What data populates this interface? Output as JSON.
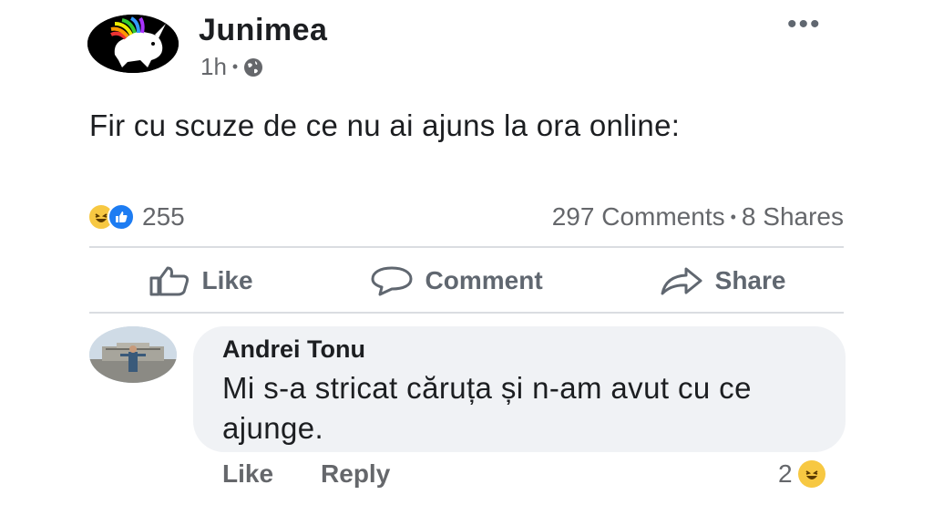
{
  "post": {
    "page_name": "Junimea",
    "time": "1h",
    "dot": "•",
    "more": "•••",
    "text": "Fir cu scuze de ce nu ai ajuns la ora online:",
    "reaction_count": "255",
    "comments_text": "297 Comments",
    "shares_text": "8 Shares"
  },
  "actions": {
    "like": "Like",
    "comment": "Comment",
    "share": "Share"
  },
  "comment": {
    "author": "Andrei Tonu",
    "text": "Mi s-a stricat căruța și n-am avut cu ce ajunge.",
    "like": "Like",
    "reply": "Reply",
    "reaction_count": "2"
  },
  "colors": {
    "haha": "#f7c842",
    "like_blue": "#1d7cf2",
    "muted": "#65676b",
    "bubble": "#f0f2f5"
  },
  "icons": [
    "page-avatar-unicorn",
    "globe-icon",
    "more-icon",
    "haha-icon",
    "like-reaction-icon",
    "thumbs-up-icon",
    "speech-bubble-icon",
    "share-arrow-icon"
  ]
}
